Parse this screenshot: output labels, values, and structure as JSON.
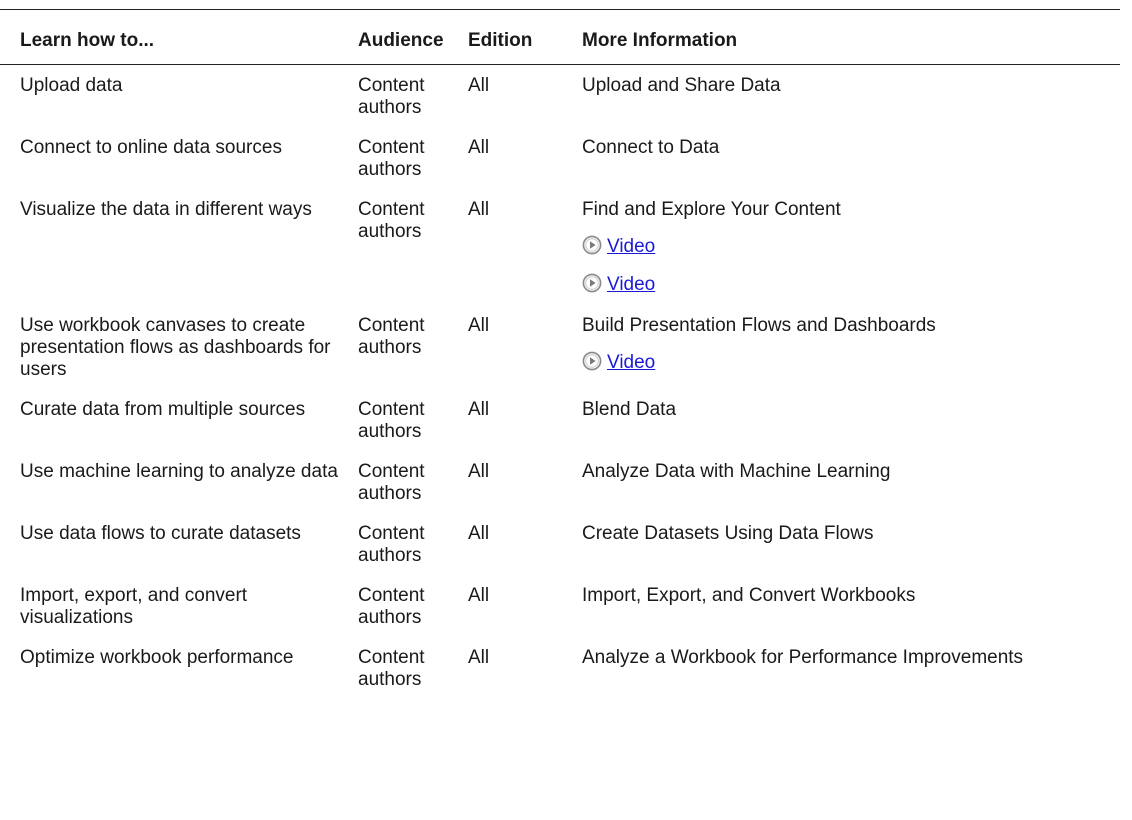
{
  "table": {
    "headers": {
      "learn": "Learn how to...",
      "audience": "Audience",
      "edition": "Edition",
      "more_info": "More Information"
    },
    "rows": [
      {
        "task": "Upload data",
        "audience": "Content authors",
        "edition": "All",
        "info": "Upload and Share Data",
        "videos": []
      },
      {
        "task": "Connect to online data sources",
        "audience": "Content authors",
        "edition": "All",
        "info": "Connect to Data",
        "videos": []
      },
      {
        "task": "Visualize the data in different ways",
        "audience": "Content authors",
        "edition": "All",
        "info": "Find and Explore Your Content",
        "videos": [
          "Video",
          "Video"
        ]
      },
      {
        "task": "Use workbook canvases to create presentation flows as dashboards for users",
        "audience": "Content authors",
        "edition": "All",
        "info": "Build Presentation Flows and Dashboards",
        "videos": [
          "Video"
        ]
      },
      {
        "task": "Curate data from multiple sources",
        "audience": "Content authors",
        "edition": "All",
        "info": "Blend Data",
        "videos": []
      },
      {
        "task": "Use machine learning to analyze data",
        "audience": "Content authors",
        "edition": "All",
        "info": "Analyze Data with Machine Learning",
        "videos": []
      },
      {
        "task": "Use data flows to curate datasets",
        "audience": "Content authors",
        "edition": "All",
        "info": "Create Datasets Using Data Flows",
        "videos": []
      },
      {
        "task": "Import, export, and convert visualizations",
        "audience": "Content authors",
        "edition": "All",
        "info": "Import, Export, and Convert Workbooks",
        "videos": []
      },
      {
        "task": "Optimize workbook performance",
        "audience": "Content authors",
        "edition": "All",
        "info": "Analyze a Workbook for Performance Improvements",
        "videos": []
      }
    ]
  },
  "icons": {
    "video": "play-circle-icon"
  },
  "colors": {
    "link": "#1a1ad6",
    "text": "#1a1a1a",
    "rule": "#222222"
  }
}
